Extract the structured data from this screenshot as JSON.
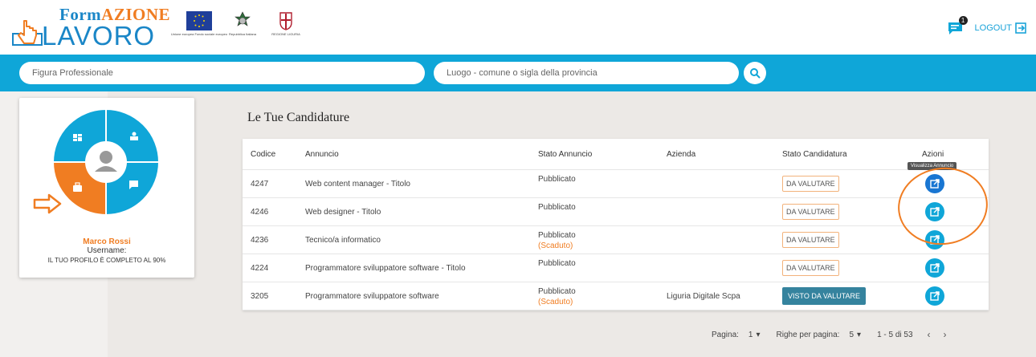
{
  "header": {
    "logo_top_a": "Form",
    "logo_top_b": "AZIONE",
    "logo_bottom": "LAVORO",
    "emblems": [
      {
        "name": "eu-flag-icon",
        "caption": "Unione europea Fondo sociale europeo"
      },
      {
        "name": "italy-emblem-icon",
        "caption": "Repubblica Italiana"
      },
      {
        "name": "liguria-emblem-icon",
        "caption": "REGIONE LIGURIA"
      }
    ],
    "notification_count": "1",
    "logout_label": "LOGOUT"
  },
  "search": {
    "figura_placeholder": "Figura Professionale",
    "luogo_placeholder": "Luogo - comune o sigla della provincia"
  },
  "profile": {
    "name": "Marco Rossi",
    "username_label": "Username:",
    "completion": "IL TUO PROFILO È COMPLETO AL 90%"
  },
  "main": {
    "title": "Le Tue Candidature",
    "columns": [
      "Codice",
      "Annuncio",
      "Stato Annuncio",
      "Azienda",
      "Stato Candidatura",
      "Azioni"
    ],
    "tooltip": "Visualizza Annuncio",
    "rows": [
      {
        "codice": "4247",
        "annuncio": "Web content manager - Titolo",
        "stato": "Pubblicato",
        "stato_extra": "",
        "azienda": "",
        "candidatura": "DA VALUTARE"
      },
      {
        "codice": "4246",
        "annuncio": "Web designer - Titolo",
        "stato": "Pubblicato",
        "stato_extra": "",
        "azienda": "",
        "candidatura": "DA VALUTARE"
      },
      {
        "codice": "4236",
        "annuncio": "Tecnico/a informatico",
        "stato": "Pubblicato",
        "stato_extra": "(Scaduto)",
        "azienda": "",
        "candidatura": "DA VALUTARE"
      },
      {
        "codice": "4224",
        "annuncio": "Programmatore sviluppatore software - Titolo",
        "stato": "Pubblicato",
        "stato_extra": "",
        "azienda": "",
        "candidatura": "DA VALUTARE"
      },
      {
        "codice": "3205",
        "annuncio": "Programmatore sviluppatore software",
        "stato": "Pubblicato",
        "stato_extra": "(Scaduto)",
        "azienda": "Liguria Digitale Scpa",
        "candidatura": "VISTO DA VALUTARE"
      }
    ]
  },
  "pagination": {
    "page_label": "Pagina:",
    "page_value": "1",
    "rows_label": "Righe per pagina:",
    "rows_value": "5",
    "range": "1 - 5 di 53",
    "prev": "‹",
    "next": "›"
  },
  "colors": {
    "accent": "#0fa6d8",
    "orange": "#f07d22",
    "brand_blue": "#1a86c7"
  }
}
